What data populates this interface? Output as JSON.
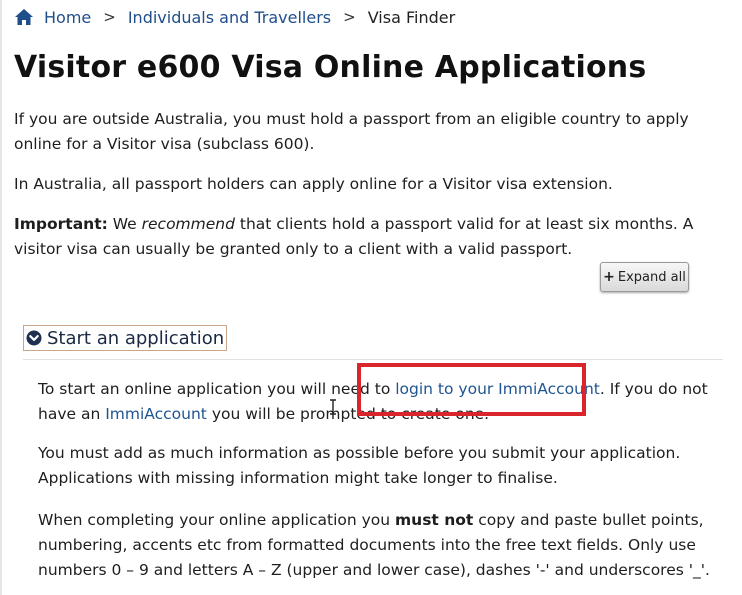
{
  "breadcrumb": {
    "home": "Home",
    "separator": ">",
    "section": "Individuals and Travellers",
    "current": "Visa Finder"
  },
  "title": "Visitor e600 Visa Online Applications",
  "intro": {
    "p1": "If you are outside Australia, you must hold a passport from an eligible country to apply online for a Visitor visa (subclass 600).",
    "p2": "In Australia, all passport holders can apply online for a Visitor visa extension.",
    "p3_strong": "Important:",
    "p3_a": " We ",
    "p3_em": "recommend",
    "p3_b": " that clients hold a passport valid for at least six months. A visitor visa can usually be granted only to a client with a valid passport."
  },
  "expand_button": {
    "icon": "plus-icon",
    "label": "Expand all"
  },
  "accordion": {
    "icon": "chevron-down-circle-icon",
    "label": "Start an application"
  },
  "body": {
    "b1_a": "To start an online application you will need to ",
    "b1_link": "login to your ImmiAccount",
    "b1_b": ". If you do not have an ",
    "b1_link2": "ImmiAccount",
    "b1_c": " you will be prompted to create one.",
    "b2": "You must add as much information as possible before you submit your application. Applications with missing information might take longer to finalise.",
    "b3_a": "When completing your online application you ",
    "b3_strong": "must not",
    "b3_b": " copy and paste bullet points, numbering, accents etc from formatted documents into the free text fields. Only use numbers 0 – 9 and letters A – Z (upper and lower case), dashes '-' and underscores '_'."
  },
  "colors": {
    "link": "#1f5592",
    "highlight": "#d9262c",
    "brand": "#1f4e8a"
  }
}
